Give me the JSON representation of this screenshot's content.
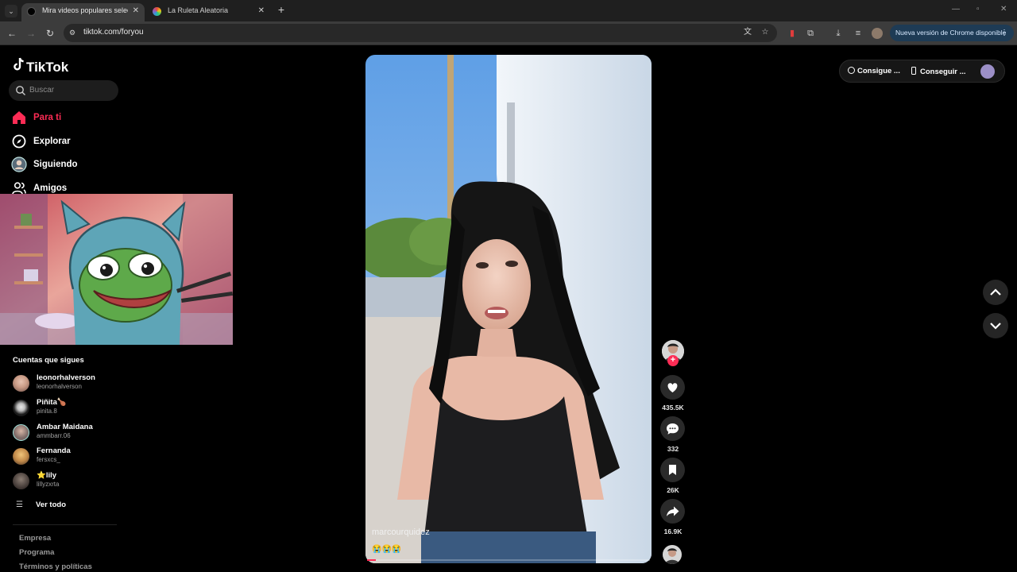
{
  "browser": {
    "tabs": [
      {
        "title": "Mira videos populares seleccionados para ti | TikTok",
        "active": true
      },
      {
        "title": "La Ruleta Aleatoria",
        "active": false
      }
    ],
    "url": "tiktok.com/foryou",
    "update_label": "Nueva versión de Chrome disponible"
  },
  "sidebar": {
    "logo": "TikTok",
    "search_placeholder": "Buscar",
    "nav": [
      {
        "label": "Para ti",
        "icon": "home-icon",
        "active": true
      },
      {
        "label": "Explorar",
        "icon": "compass-icon",
        "active": false
      },
      {
        "label": "Siguiendo",
        "icon": "following-avatar-icon",
        "active": false
      },
      {
        "label": "Amigos",
        "icon": "friends-icon",
        "active": false
      }
    ],
    "following_title": "Cuentas que sigues",
    "accounts": [
      {
        "name": "leonorhalverson",
        "handle": "leonorhalverson"
      },
      {
        "name": "Piñita🍗",
        "handle": "pinita.8"
      },
      {
        "name": "Ambar Maidana",
        "handle": "ammbarr.06"
      },
      {
        "name": "Fernanda",
        "handle": "fersxcs_"
      },
      {
        "name": "⭐lily",
        "handle": "lillyzxrta"
      }
    ],
    "see_all": "Ver todo",
    "footer": [
      "Empresa",
      "Programa",
      "Términos y políticas"
    ]
  },
  "video": {
    "author": "marcourquidez",
    "caption_emojis": "😭😭😭",
    "progress": 0.03
  },
  "actions": {
    "likes": "435.5K",
    "comments": "332",
    "saves": "26K",
    "shares": "16.9K"
  },
  "topbar": {
    "get_coins": "Consigue ...",
    "get_app": "Conseguir ..."
  },
  "colors": {
    "accent": "#fe2c55",
    "background": "#000000"
  }
}
